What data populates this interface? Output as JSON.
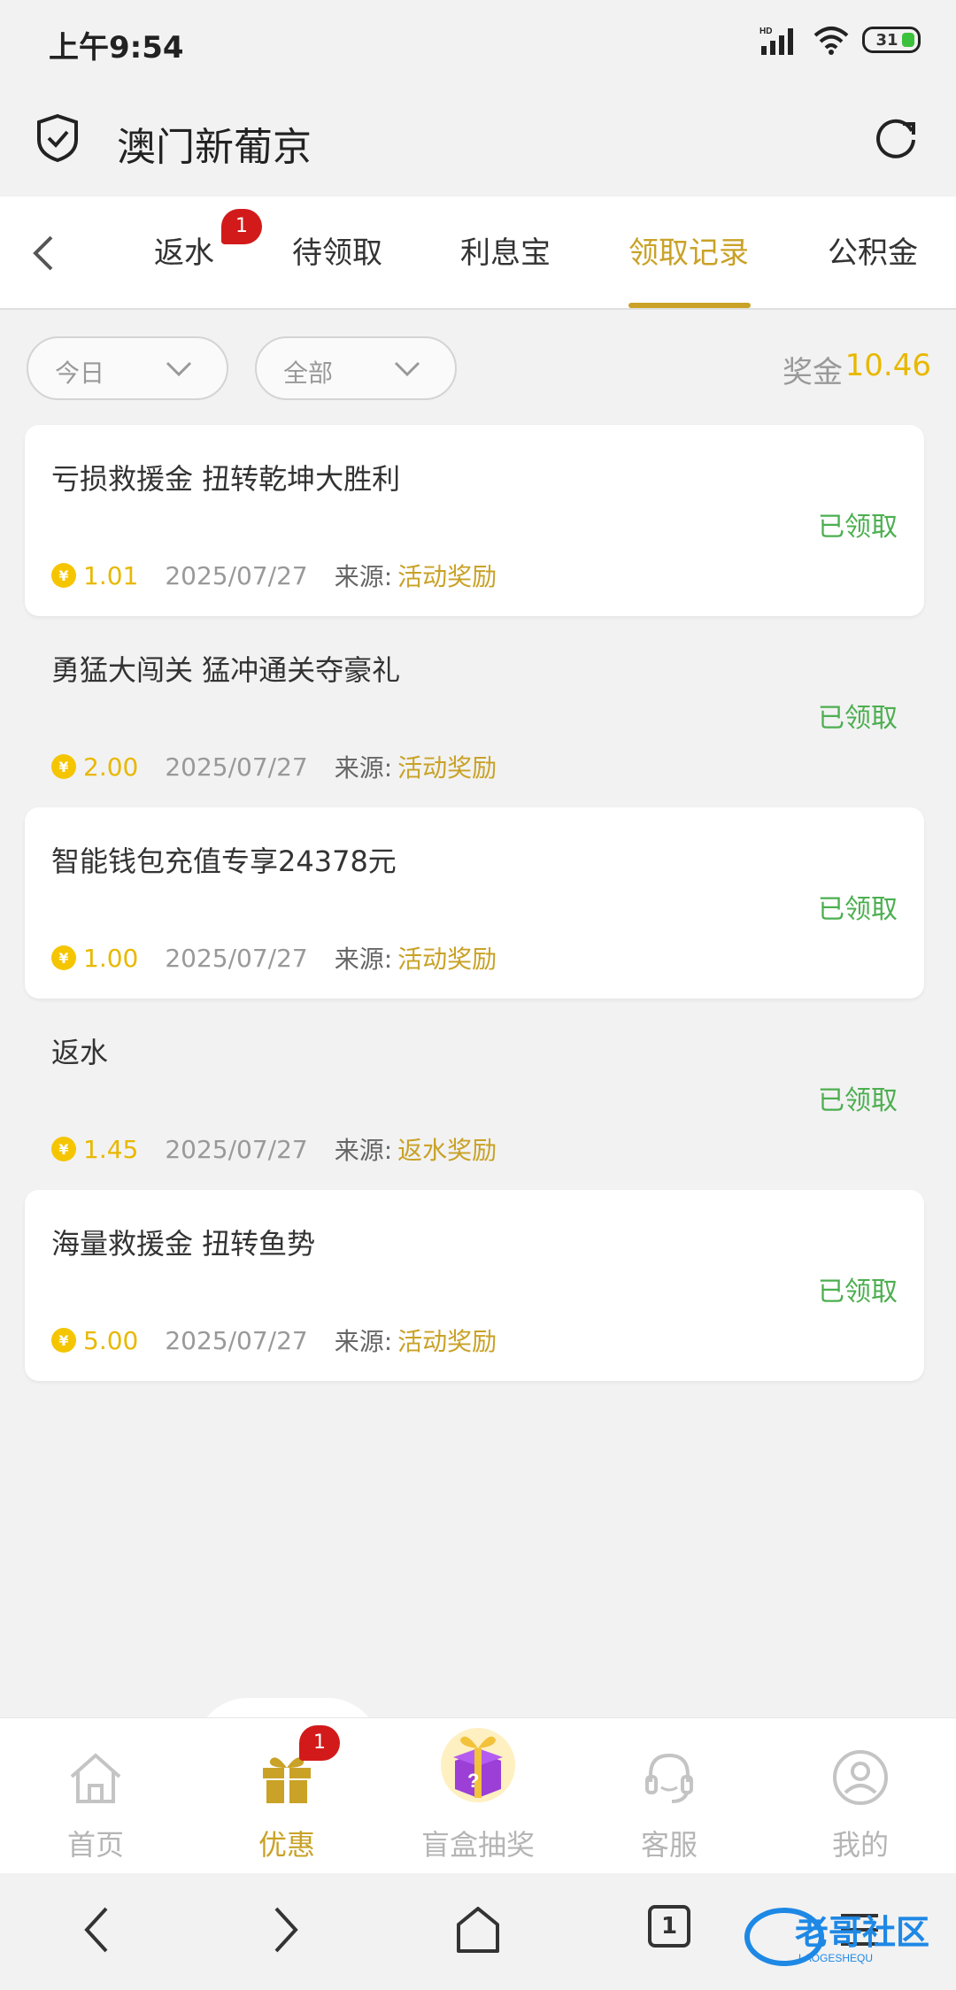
{
  "status_bar": {
    "time": "上午9:54",
    "battery": "31"
  },
  "header": {
    "title": "澳门新葡京"
  },
  "tabs": [
    {
      "label": "返水",
      "badge": "1"
    },
    {
      "label": "待领取"
    },
    {
      "label": "利息宝"
    },
    {
      "label": "领取记录",
      "active": true
    },
    {
      "label": "公积金"
    }
  ],
  "filters": {
    "date": "今日",
    "type": "全部"
  },
  "bonus": {
    "label": "奖金",
    "value": "10.46"
  },
  "records": [
    {
      "title": "亏损救援金 扭转乾坤大胜利",
      "status": "已领取",
      "amount": "1.01",
      "date": "2025/07/27",
      "source_label": "来源:",
      "source": "活动奖励"
    },
    {
      "title": "勇猛大闯关 猛冲通关夺豪礼",
      "status": "已领取",
      "amount": "2.00",
      "date": "2025/07/27",
      "source_label": "来源:",
      "source": "活动奖励"
    },
    {
      "title": "智能钱包充值专享24378元",
      "status": "已领取",
      "amount": "1.00",
      "date": "2025/07/27",
      "source_label": "来源:",
      "source": "活动奖励"
    },
    {
      "title": "返水",
      "status": "已领取",
      "amount": "1.45",
      "date": "2025/07/27",
      "source_label": "来源:",
      "source": "返水奖励"
    },
    {
      "title": "海量救援金 扭转鱼势",
      "status": "已领取",
      "amount": "5.00",
      "date": "2025/07/27",
      "source_label": "来源:",
      "source": "活动奖励"
    }
  ],
  "coin_symbol": "¥",
  "bottom_nav": [
    {
      "label": "首页",
      "icon": "home-icon"
    },
    {
      "label": "优惠",
      "icon": "gift-icon",
      "active": true,
      "badge": "1"
    },
    {
      "label": "盲盒抽奖",
      "icon": "mystery-box-icon"
    },
    {
      "label": "客服",
      "icon": "headset-icon"
    },
    {
      "label": "我的",
      "icon": "user-icon"
    }
  ],
  "system_nav": {
    "tab_count": "1"
  },
  "watermark": {
    "text": "老哥社区",
    "sub": "LAOGESHEQU"
  },
  "colors": {
    "accent": "#c9a227",
    "bonus": "#e8b800",
    "success": "#4caf50",
    "badge": "#d21a1a"
  }
}
